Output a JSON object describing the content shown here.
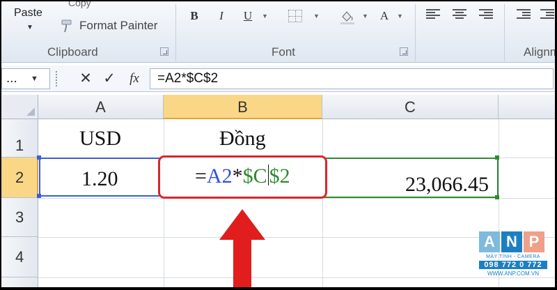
{
  "ribbon": {
    "clipboard": {
      "paste_label": "Paste",
      "copy_label_fragment": "Copy",
      "format_painter_label": "Format Painter",
      "group_label": "Clipboard"
    },
    "font": {
      "bold": "B",
      "italic": "I",
      "underline": "U",
      "font_color": "A",
      "group_label": "Font"
    },
    "alignment": {
      "group_label_fragment": "Alignm"
    }
  },
  "formula_bar": {
    "name_box": "...",
    "cancel_symbol": "✕",
    "enter_symbol": "✓",
    "fx_symbol": "fx",
    "formula": "=A2*$C$2"
  },
  "grid": {
    "columns": [
      "A",
      "B",
      "C"
    ],
    "rows": [
      "1",
      "2",
      "3",
      "4"
    ],
    "cells": {
      "A1": "USD",
      "B1": "Đồng",
      "A2": "1.20",
      "C2": "23,066.45"
    },
    "edit_cell": {
      "eq": "=",
      "ref_a2": "A2",
      "op": "*",
      "ref_c2_part1": "$C",
      "ref_c2_part2": "$2"
    }
  },
  "colors": {
    "ref_blue": "#2f4fd8",
    "ref_green": "#2f8a2f",
    "highlight_red": "#e11d1d",
    "active_header": "#f9d787"
  },
  "watermark": {
    "letters": [
      "A",
      "N",
      "P"
    ],
    "tagline": "MÁY TÍNH - CAMERA",
    "phone": "098 772 0 772",
    "url": "WWW.ANP.COM.VN"
  }
}
